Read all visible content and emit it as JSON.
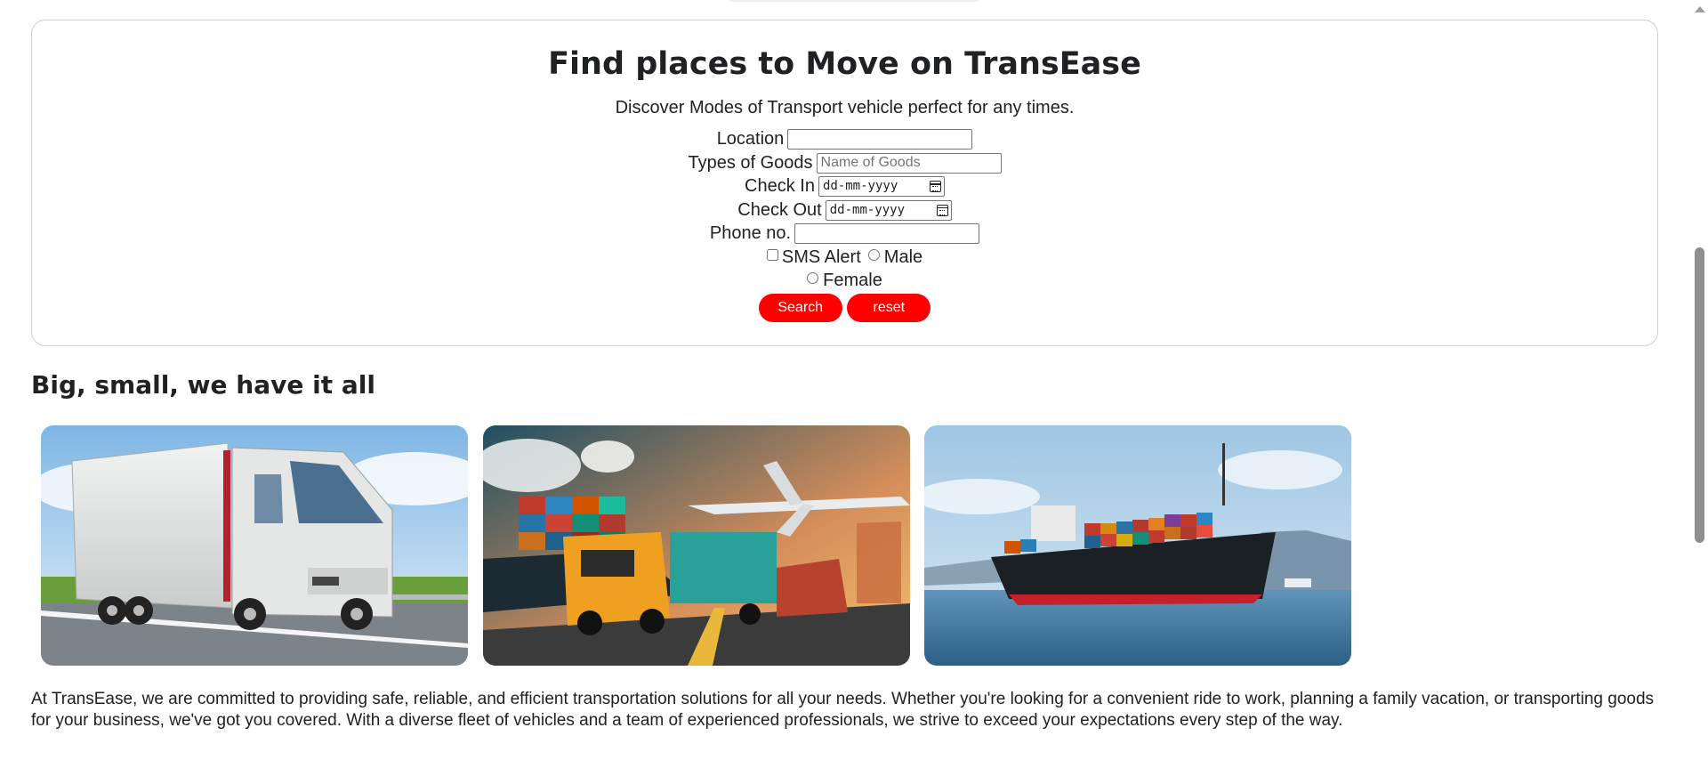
{
  "search": {
    "title": "Find places to Move on TransEase",
    "subtitle": "Discover Modes of Transport vehicle perfect for any times.",
    "location_label": "Location",
    "location_value": "",
    "goods_label": "Types of Goods",
    "goods_placeholder": "Name of Goods",
    "checkin_label": "Check In",
    "checkin_value": "dd-mm-yyyy",
    "checkout_label": "Check Out",
    "checkout_value": "dd-mm-yyyy",
    "phone_label": "Phone no.",
    "phone_value": "",
    "sms_label": "SMS Alert",
    "male_label": "Male",
    "female_label": "Female",
    "search_button": "Search",
    "reset_button": "reset"
  },
  "gallery": {
    "title": "Big, small, we have it all",
    "images": [
      "truck-image",
      "cargo-logistics-image",
      "container-ship-image"
    ]
  },
  "about": {
    "text": "At TransEase, we are committed to providing safe, reliable, and efficient transportation solutions for all your needs. Whether you're looking for a convenient ride to work, planning a family vacation, or transporting goods for your business, we've got you covered. With a diverse fleet of vehicles and a team of experienced professionals, we strive to exceed your expectations every step of the way."
  },
  "colors": {
    "button": "#ff0000",
    "text": "#202124",
    "card_border": "#cfcfcf"
  }
}
